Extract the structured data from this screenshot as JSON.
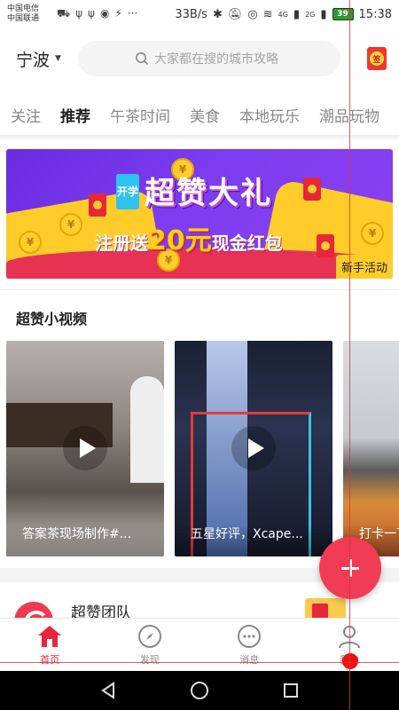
{
  "status_bar": {
    "carrier_1": "中国电信",
    "carrier_2": "中国联通",
    "speed": "33B/s",
    "network": "4G",
    "network_2": "2G",
    "battery": "39",
    "time": "15:38"
  },
  "header": {
    "city": "宁波",
    "search_placeholder": "大家都在搜的城市攻略",
    "signin_label": "签"
  },
  "tabs": [
    {
      "label": "关注",
      "active": false
    },
    {
      "label": "推荐",
      "active": true
    },
    {
      "label": "午茶时间",
      "active": false
    },
    {
      "label": "美食",
      "active": false
    },
    {
      "label": "本地玩乐",
      "active": false
    },
    {
      "label": "潮品玩物",
      "active": false
    }
  ],
  "banner": {
    "tag": "开学",
    "title": "超赞大礼",
    "subtitle_prefix": "注册送",
    "amount": "20元",
    "subtitle_suffix": "现金红包",
    "badge": "新手活动"
  },
  "section": {
    "title": "超赞小视频"
  },
  "videos": [
    {
      "caption": "答案茶现场制作#..."
    },
    {
      "caption": "五星好评，Xcape..."
    },
    {
      "caption": "打卡一下"
    }
  ],
  "team": {
    "name": "超赞团队"
  },
  "bottom_nav": [
    {
      "label": "首页",
      "icon": "home-icon",
      "active": true
    },
    {
      "label": "发现",
      "icon": "compass-icon",
      "active": false
    },
    {
      "label": "消息",
      "icon": "message-icon",
      "active": false
    },
    {
      "label": "我的",
      "icon": "profile-icon",
      "active": false
    }
  ],
  "colors": {
    "accent": "#e8263a",
    "fab": "#f23b55"
  }
}
